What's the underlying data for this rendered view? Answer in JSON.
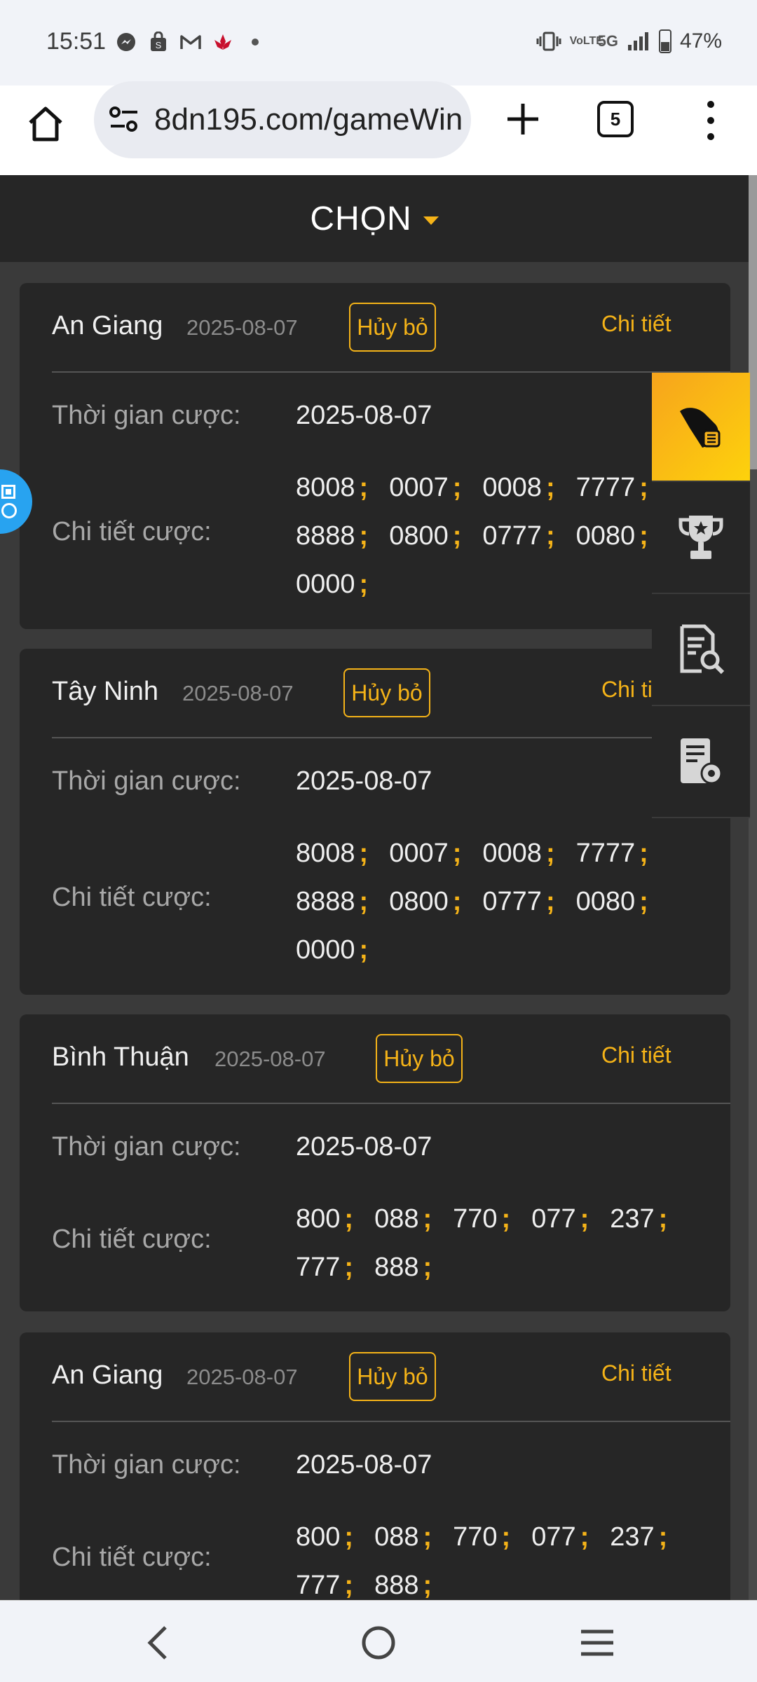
{
  "status_bar": {
    "time": "15:51",
    "network_lte": "VoLTE",
    "network_5g": "5G",
    "battery": "47%"
  },
  "browser": {
    "url": "8dn195.com/gameWin",
    "tab_count": "5"
  },
  "header": {
    "title": "CHỌN"
  },
  "labels": {
    "time_label": "Thời gian cược:",
    "detail_label": "Chi tiết cược:",
    "cancel": "Hủy bỏ",
    "detail_link": "Chi tiết"
  },
  "bets": [
    {
      "province": "An Giang",
      "date": "2025-08-07",
      "time": "2025-08-07",
      "numbers": [
        "8008",
        "0007",
        "0008",
        "7777",
        "8888",
        "0800",
        "0777",
        "0080",
        "0000"
      ]
    },
    {
      "province": "Tây Ninh",
      "date": "2025-08-07",
      "time": "2025-08-07",
      "numbers": [
        "8008",
        "0007",
        "0008",
        "7777",
        "8888",
        "0800",
        "0777",
        "0080",
        "0000"
      ]
    },
    {
      "province": "Bình Thuận",
      "date": "2025-08-07",
      "time": "2025-08-07",
      "numbers": [
        "800",
        "088",
        "770",
        "077",
        "237",
        "777",
        "888"
      ]
    },
    {
      "province": "An Giang",
      "date": "2025-08-07",
      "time": "2025-08-07",
      "numbers": [
        "800",
        "088",
        "770",
        "077",
        "237",
        "777",
        "888"
      ]
    }
  ],
  "icons": {
    "float_menu": [
      "hand-coin-icon",
      "trophy-icon",
      "document-search-icon",
      "bill-settings-icon"
    ],
    "accent_color": "#f5b318"
  }
}
